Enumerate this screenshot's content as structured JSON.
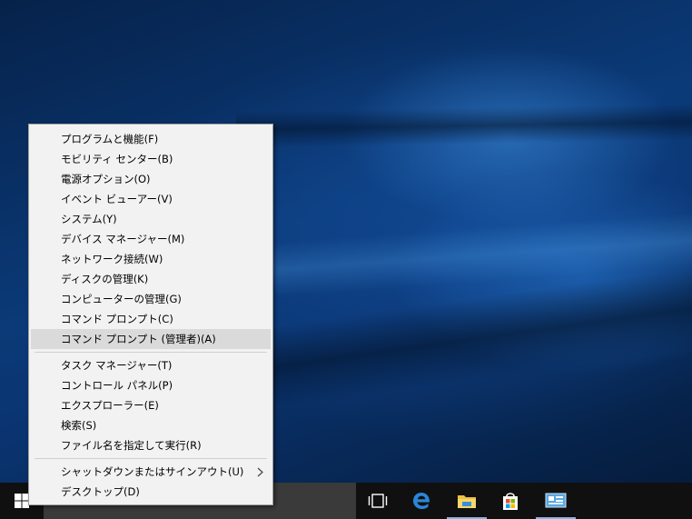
{
  "context_menu": {
    "group1": [
      {
        "label": "プログラムと機能(F)"
      },
      {
        "label": "モビリティ センター(B)"
      },
      {
        "label": "電源オプション(O)"
      },
      {
        "label": "イベント ビューアー(V)"
      },
      {
        "label": "システム(Y)"
      },
      {
        "label": "デバイス マネージャー(M)"
      },
      {
        "label": "ネットワーク接続(W)"
      },
      {
        "label": "ディスクの管理(K)"
      },
      {
        "label": "コンピューターの管理(G)"
      },
      {
        "label": "コマンド プロンプト(C)"
      },
      {
        "label": "コマンド プロンプト (管理者)(A)",
        "highlighted": true
      }
    ],
    "group2": [
      {
        "label": "タスク マネージャー(T)"
      },
      {
        "label": "コントロール パネル(P)"
      },
      {
        "label": "エクスプローラー(E)"
      },
      {
        "label": "検索(S)"
      },
      {
        "label": "ファイル名を指定して実行(R)"
      }
    ],
    "group3": [
      {
        "label": "シャットダウンまたはサインアウト(U)",
        "has_submenu": true
      },
      {
        "label": "デスクトップ(D)"
      }
    ]
  },
  "taskbar": {
    "search_text": "",
    "icons": [
      "windows-logo-icon",
      "task-view-icon",
      "edge-browser-icon",
      "file-explorer-icon",
      "store-icon",
      "control-panel-icon"
    ],
    "accent": "#8ab4e8"
  },
  "colors": {
    "menu_bg": "#f2f2f2",
    "menu_highlight": "#dadada",
    "taskbar_bg": "#101010",
    "search_bg": "#3a3a3a"
  }
}
